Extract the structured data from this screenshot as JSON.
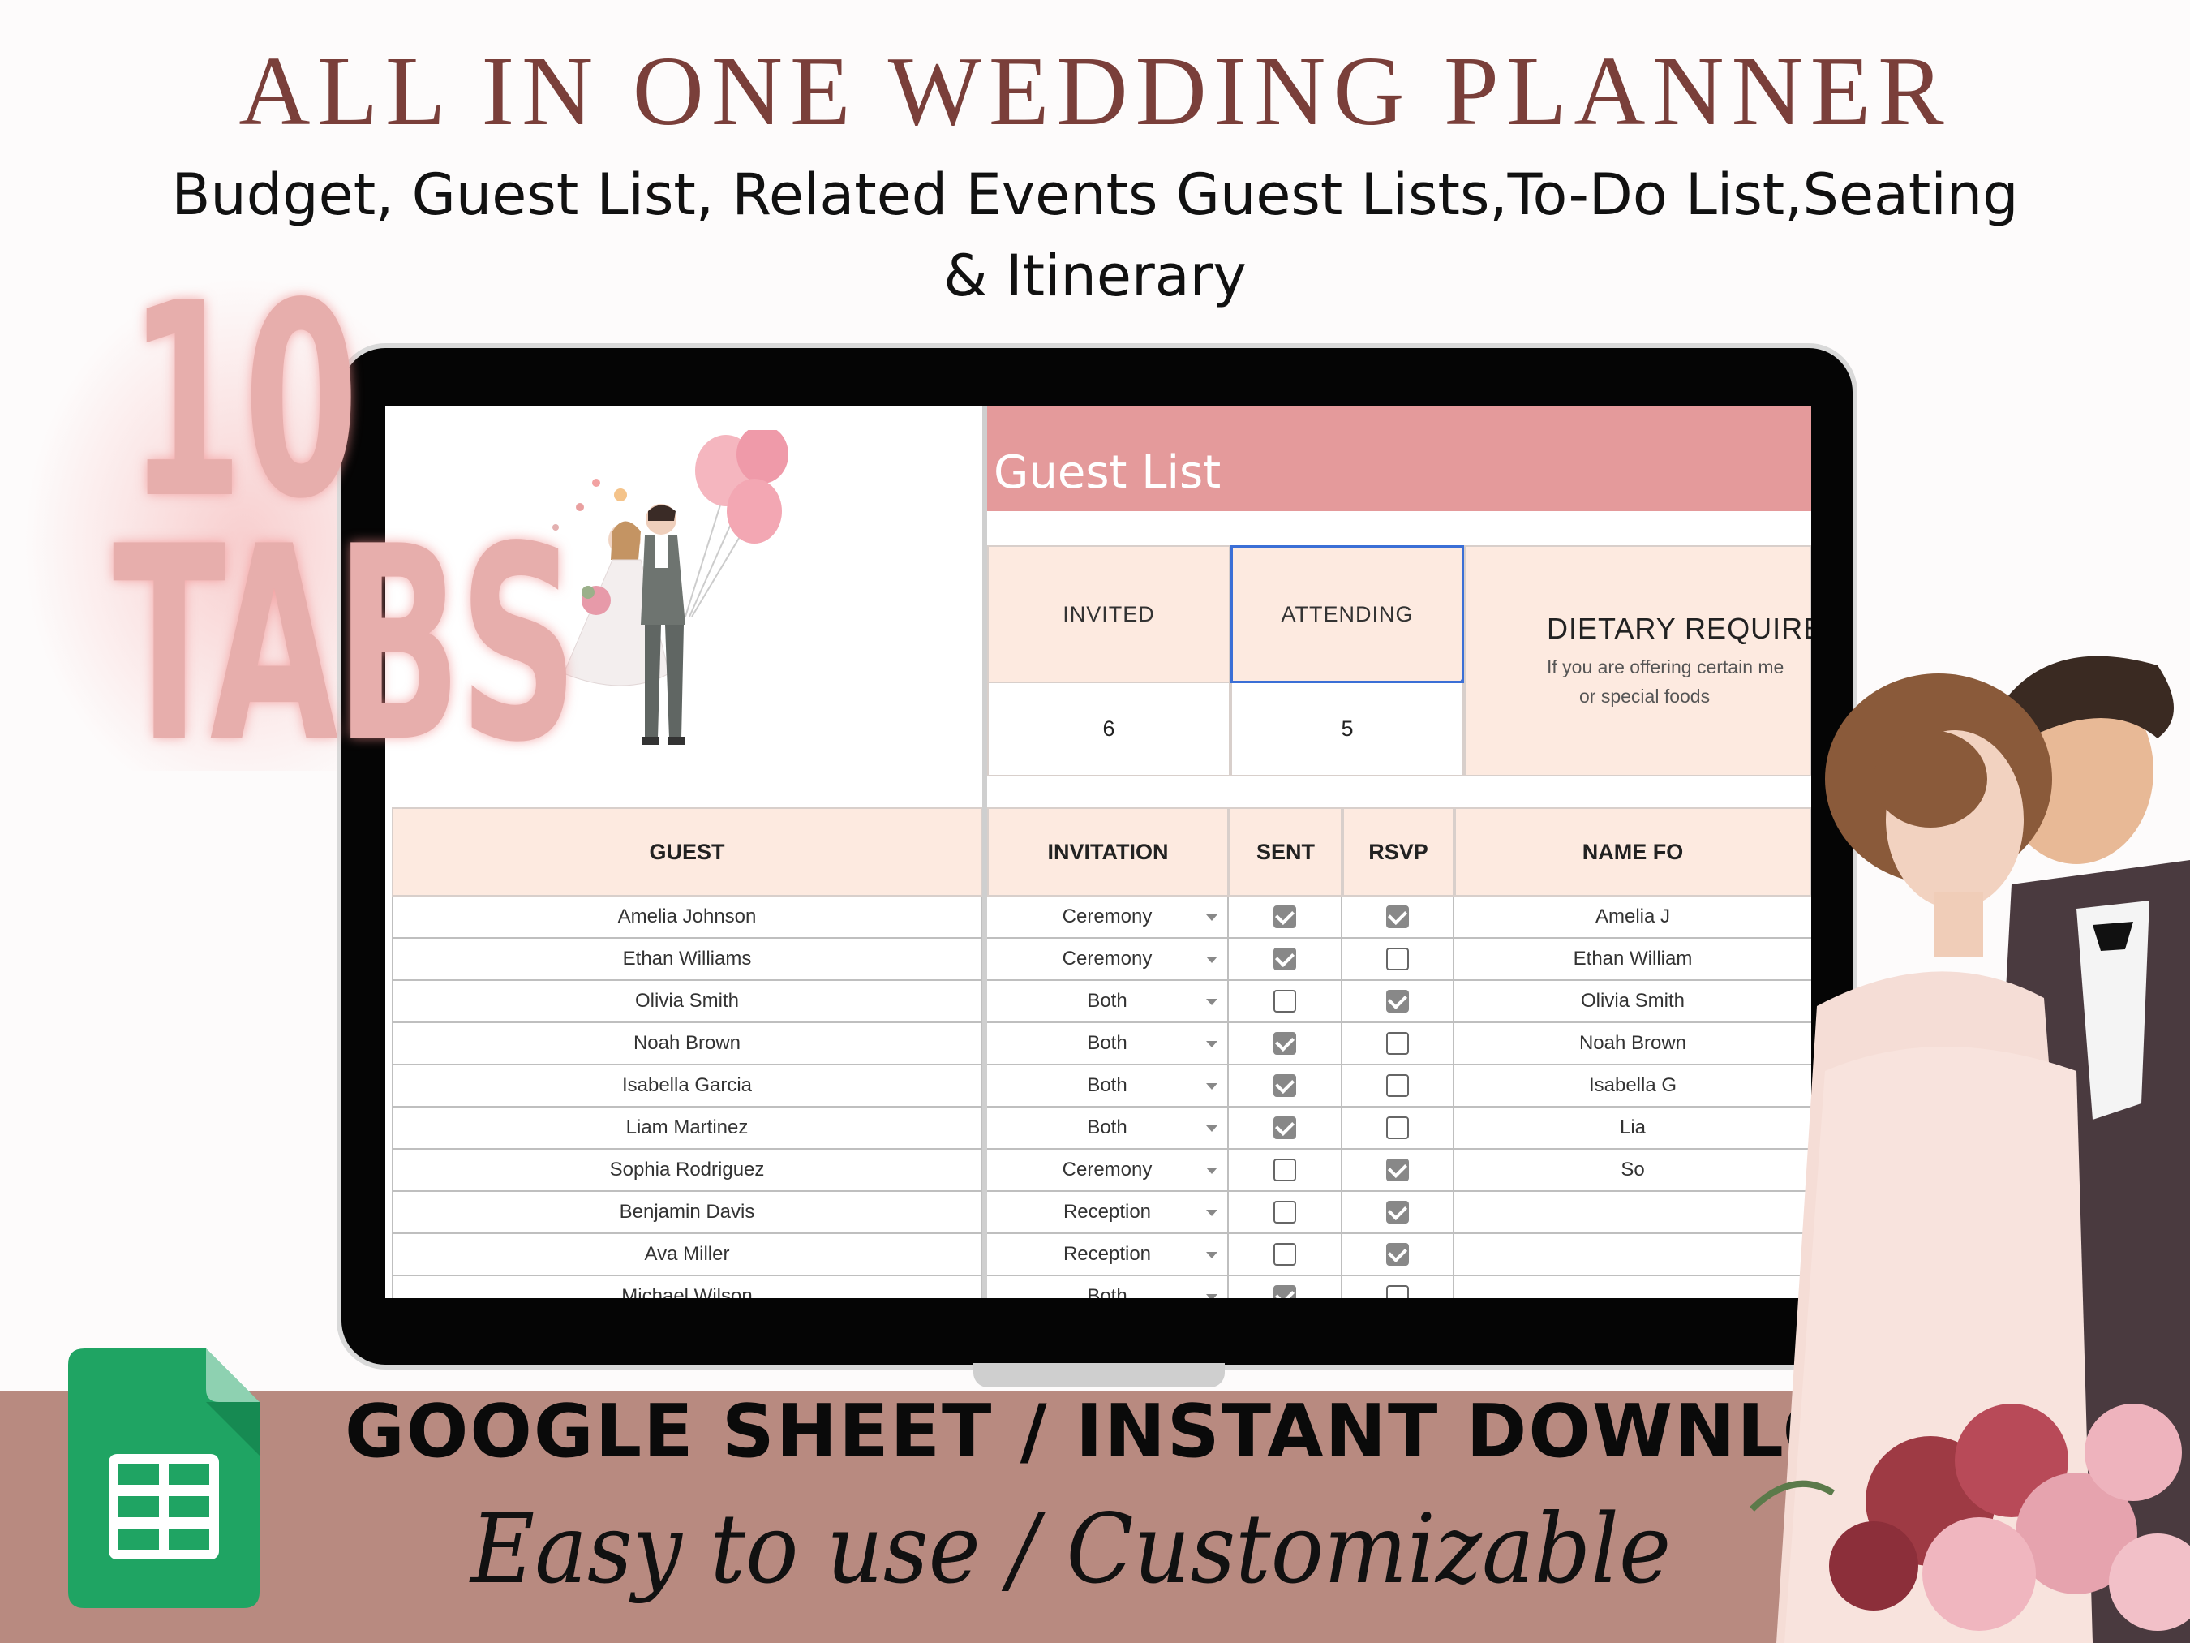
{
  "header": {
    "title": "ALL IN ONE WEDDING PLANNER",
    "subtitle_line1": "Budget, Guest List, Related Events Guest Lists,To-Do List,Seating",
    "subtitle_line2": "& Itinerary"
  },
  "badge": {
    "number": "10",
    "word": "TABS"
  },
  "sheet": {
    "title": "Guest List",
    "stats": {
      "invited_label": "INVITED",
      "attending_label": "ATTENDING",
      "invited_value": "6",
      "attending_value": "5"
    },
    "dietary": {
      "title": "DIETARY REQUIRE",
      "note_line1": "If you are offering certain me",
      "note_line2": "or special foods"
    },
    "columns": {
      "guest": "GUEST",
      "invitation": "INVITATION",
      "sent": "SENT",
      "rsvp": "RSVP",
      "name_for": "NAME FO"
    },
    "rows": [
      {
        "guest": "Amelia Johnson",
        "invitation": "Ceremony",
        "sent": true,
        "rsvp": true,
        "name": "Amelia J"
      },
      {
        "guest": "Ethan Williams",
        "invitation": "Ceremony",
        "sent": true,
        "rsvp": false,
        "name": "Ethan William"
      },
      {
        "guest": "Olivia Smith",
        "invitation": "Both",
        "sent": false,
        "rsvp": true,
        "name": "Olivia Smith"
      },
      {
        "guest": "Noah Brown",
        "invitation": "Both",
        "sent": true,
        "rsvp": false,
        "name": "Noah Brown"
      },
      {
        "guest": "Isabella Garcia",
        "invitation": "Both",
        "sent": true,
        "rsvp": false,
        "name": "Isabella G"
      },
      {
        "guest": "Liam Martinez",
        "invitation": "Both",
        "sent": true,
        "rsvp": false,
        "name": "Lia"
      },
      {
        "guest": "Sophia Rodriguez",
        "invitation": "Ceremony",
        "sent": false,
        "rsvp": true,
        "name": "So"
      },
      {
        "guest": "Benjamin Davis",
        "invitation": "Reception",
        "sent": false,
        "rsvp": true,
        "name": ""
      },
      {
        "guest": "Ava Miller",
        "invitation": "Reception",
        "sent": false,
        "rsvp": true,
        "name": ""
      },
      {
        "guest": "Michael Wilson",
        "invitation": "Both",
        "sent": true,
        "rsvp": false,
        "name": ""
      }
    ]
  },
  "banner": {
    "download": "GOOGLE SHEET / INSTANT DOWNLOAD",
    "tagline": "Easy to use / Customizable"
  },
  "colors": {
    "title": "#7a3f3a",
    "header_pink": "#e49a9b",
    "peach": "#fdeae0",
    "banner": "#b88a80",
    "badge": "#e7aeac",
    "sheets_green": "#1fa463"
  },
  "icons": [
    "google-sheets-icon",
    "dropdown-arrow-icon",
    "checkbox-icon"
  ]
}
